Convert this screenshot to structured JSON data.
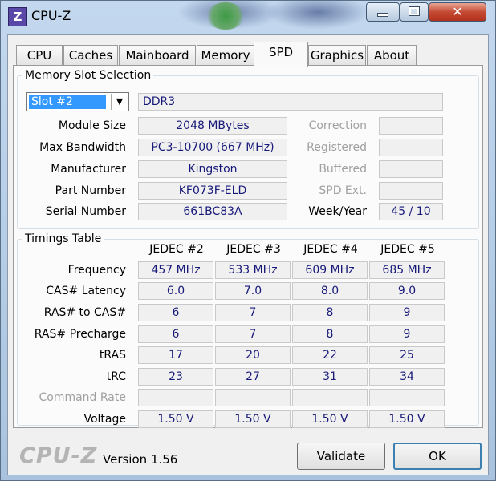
{
  "window": {
    "title": "CPU-Z",
    "icon_letter": "Z",
    "close_glyph": "✕"
  },
  "tabs": [
    "CPU",
    "Caches",
    "Mainboard",
    "Memory",
    "SPD",
    "Graphics",
    "About"
  ],
  "active_tab": "SPD",
  "slot_group": {
    "legend": "Memory Slot Selection",
    "slot_value": "Slot #2",
    "type_value": "DDR3",
    "labels": {
      "module_size": "Module Size",
      "max_bandwidth": "Max Bandwidth",
      "manufacturer": "Manufacturer",
      "part_number": "Part Number",
      "serial_number": "Serial Number"
    },
    "values": {
      "module_size": "2048 MBytes",
      "max_bandwidth": "PC3-10700 (667 MHz)",
      "manufacturer": "Kingston",
      "part_number": "KF073F-ELD",
      "serial_number": "661BC83A"
    },
    "right_labels": {
      "correction": "Correction",
      "registered": "Registered",
      "buffered": "Buffered",
      "spd_ext": "SPD Ext.",
      "week_year": "Week/Year"
    },
    "right_values": {
      "correction": "",
      "registered": "",
      "buffered": "",
      "spd_ext": "",
      "week_year": "45 / 10"
    }
  },
  "timings": {
    "legend": "Timings Table",
    "columns": [
      "JEDEC #2",
      "JEDEC #3",
      "JEDEC #4",
      "JEDEC #5"
    ],
    "rows": [
      {
        "label": "Frequency",
        "values": [
          "457 MHz",
          "533 MHz",
          "609 MHz",
          "685 MHz"
        ]
      },
      {
        "label": "CAS# Latency",
        "values": [
          "6.0",
          "7.0",
          "8.0",
          "9.0"
        ]
      },
      {
        "label": "RAS# to CAS#",
        "values": [
          "6",
          "7",
          "8",
          "9"
        ]
      },
      {
        "label": "RAS# Precharge",
        "values": [
          "6",
          "7",
          "8",
          "9"
        ]
      },
      {
        "label": "tRAS",
        "values": [
          "17",
          "20",
          "22",
          "25"
        ]
      },
      {
        "label": "tRC",
        "values": [
          "23",
          "27",
          "31",
          "34"
        ]
      },
      {
        "label": "Command Rate",
        "values": [
          "",
          "",
          "",
          ""
        ]
      },
      {
        "label": "Voltage",
        "values": [
          "1.50 V",
          "1.50 V",
          "1.50 V",
          "1.50 V"
        ]
      }
    ]
  },
  "footer": {
    "logo": "CPU-Z",
    "version": "Version 1.56",
    "validate_label": "Validate",
    "ok_label": "OK"
  }
}
